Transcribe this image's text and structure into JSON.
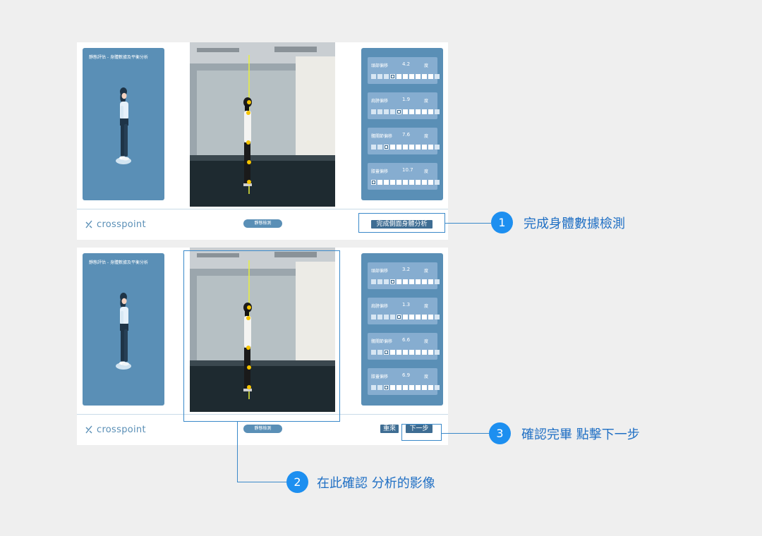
{
  "screens": [
    {
      "panel_title": "靜態評估 - 身體數據及平衡分析",
      "mode_pill": "靜態檢測",
      "brand": "crosspoint",
      "metrics": [
        {
          "label": "頭部偏移",
          "value": "4.2",
          "unit": "度",
          "marker_index": 3
        },
        {
          "label": "肩膀偏移",
          "value": "1.9",
          "unit": "度",
          "marker_index": 4
        },
        {
          "label": "髖關節偏移",
          "value": "7.6",
          "unit": "度",
          "marker_index": 2
        },
        {
          "label": "膝蓋偏移",
          "value": "10.7",
          "unit": "度",
          "marker_index": 0
        }
      ],
      "action_button": "完成側面身體分析"
    },
    {
      "panel_title": "靜態評估 - 身體數據及平衡分析",
      "mode_pill": "靜態檢測",
      "brand": "crosspoint",
      "metrics": [
        {
          "label": "頭部偏移",
          "value": "3.2",
          "unit": "度",
          "marker_index": 3
        },
        {
          "label": "肩膀偏移",
          "value": "1.3",
          "unit": "度",
          "marker_index": 4
        },
        {
          "label": "髖關節偏移",
          "value": "6.6",
          "unit": "度",
          "marker_index": 2
        },
        {
          "label": "膝蓋偏移",
          "value": "6.9",
          "unit": "度",
          "marker_index": 2
        }
      ],
      "retry_button": "重來",
      "next_button": "下一步"
    }
  ],
  "callouts": [
    {
      "number": "1",
      "text": "完成身體數據檢測"
    },
    {
      "number": "2",
      "text": "在此確認 分析的影像"
    },
    {
      "number": "3",
      "text": "確認完畢 點擊下一步"
    }
  ],
  "colors": {
    "panel": "#5a8fb6",
    "metric_card": "#86add0",
    "callout_badge": "#1d8ff0",
    "callout_text": "#1f6fc4",
    "plumb_line": "#e8f03a"
  },
  "icons": [
    "person-avatar-icon",
    "crosspoint-logo-icon"
  ]
}
